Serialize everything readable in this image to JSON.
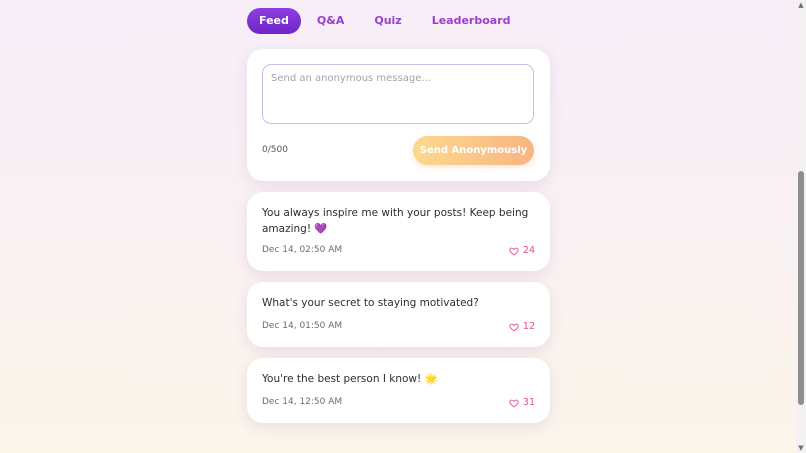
{
  "tabs": [
    {
      "label": "Feed",
      "active": true
    },
    {
      "label": "Q&A",
      "active": false
    },
    {
      "label": "Quiz",
      "active": false
    },
    {
      "label": "Leaderboard",
      "active": false
    }
  ],
  "compose": {
    "placeholder": "Send an anonymous message...",
    "value": "",
    "counter": "0/500",
    "send_label": "Send Anonymously"
  },
  "posts": [
    {
      "text": "You always inspire me with your posts! Keep being amazing! 💜",
      "time": "Dec 14, 02:50 AM",
      "likes": "24"
    },
    {
      "text": "What's your secret to staying motivated?",
      "time": "Dec 14, 01:50 AM",
      "likes": "12"
    },
    {
      "text": "You're the best person I know! 🌟",
      "time": "Dec 14, 12:50 AM",
      "likes": "31"
    }
  ],
  "colors": {
    "accent": "#7a2fd4",
    "tab_text": "#9b3fd0",
    "like": "#e24e95",
    "send_gradient_start": "#fcd98e",
    "send_gradient_end": "#f7b582"
  },
  "icons": {
    "like": "heart-outline-icon",
    "scroll_up": "arrow-up-icon",
    "scroll_down": "arrow-down-icon"
  }
}
